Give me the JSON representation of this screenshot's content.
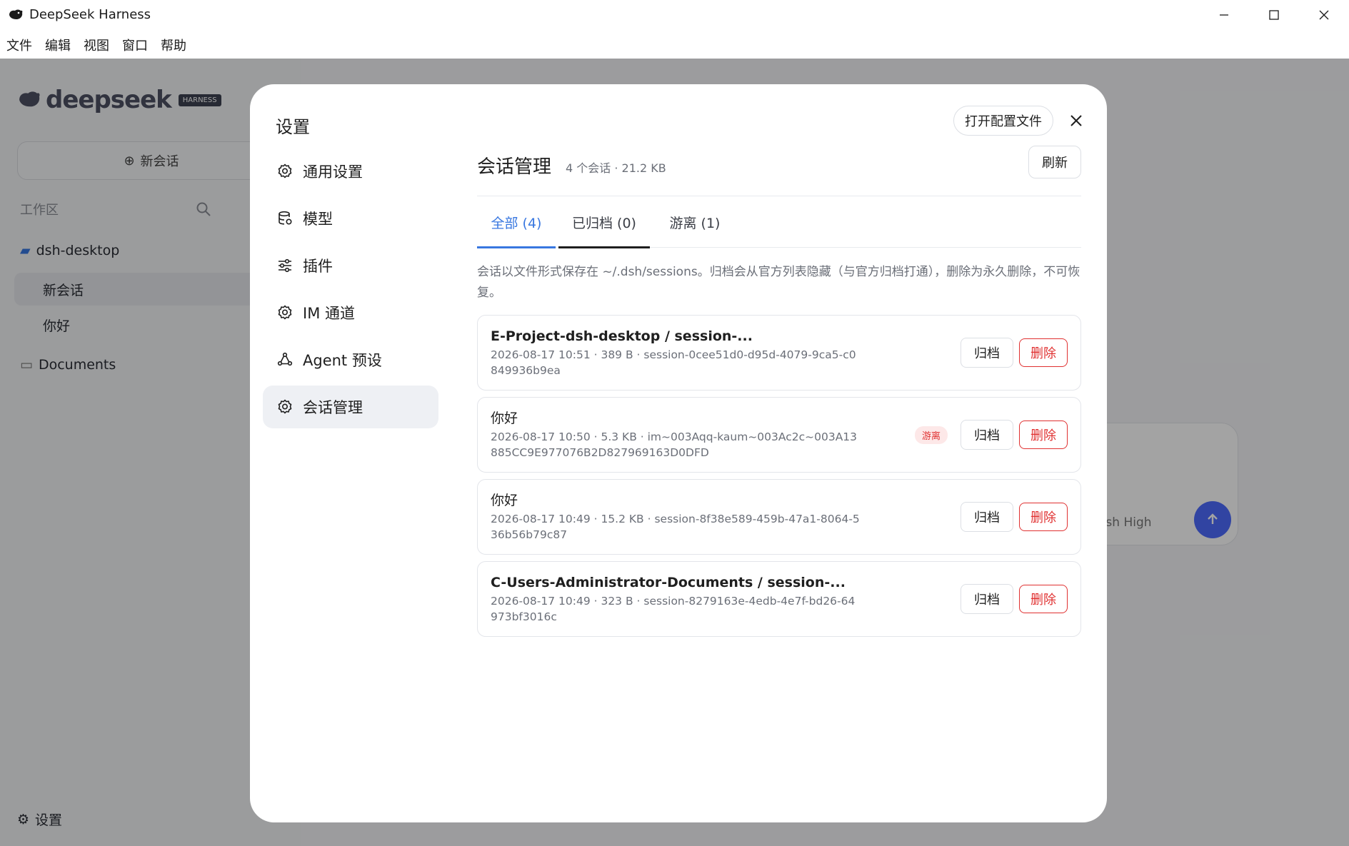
{
  "window": {
    "title": "DeepSeek Harness",
    "minimize_icon": "minimize-icon",
    "maximize_icon": "maximize-icon",
    "close_icon": "close-icon"
  },
  "menu": [
    "文件",
    "编辑",
    "视图",
    "窗口",
    "帮助"
  ],
  "sidebar": {
    "logo_text": "deepseek",
    "logo_badge": "HARNESS",
    "new_chat": "新会话",
    "section_label": "工作区",
    "workspace": "dsh-desktop",
    "sessions": [
      "新会话",
      "你好"
    ],
    "folder": "Documents",
    "settings": "设置"
  },
  "composer": {
    "model_label": "ash High"
  },
  "modal": {
    "title": "设置",
    "open_config": "打开配置文件",
    "nav": [
      {
        "label": "通用设置",
        "icon": "gear-icon"
      },
      {
        "label": "模型",
        "icon": "database-icon"
      },
      {
        "label": "插件",
        "icon": "sliders-icon"
      },
      {
        "label": "IM 通道",
        "icon": "gear-icon"
      },
      {
        "label": "Agent 预设",
        "icon": "agent-icon"
      },
      {
        "label": "会话管理",
        "icon": "gear-icon"
      }
    ],
    "active_nav": 5,
    "section": {
      "title": "会话管理",
      "meta": "4 个会话 · 21.2 KB",
      "refresh": "刷新",
      "tabs": [
        {
          "label": "全部 (4)",
          "state": "active"
        },
        {
          "label": "已归档 (0)",
          "state": "underlined"
        },
        {
          "label": "游离 (1)",
          "state": "normal"
        }
      ],
      "description": "会话以文件形式保存在 ~/.dsh/sessions。归档会从官方列表隐藏（与官方归档打通），删除为永久删除，不可恢复。",
      "archive_label": "归档",
      "delete_label": "删除",
      "orphan_label": "游离",
      "sessions": [
        {
          "title": "E-Project-dsh-desktop / session-...",
          "meta": "2026-08-17 10:51 · 389 B · session-0cee51d0-d95d-4079-9ca5-c0849936b9ea",
          "orphan": false,
          "bold": true
        },
        {
          "title": "你好",
          "meta": "2026-08-17 10:50 · 5.3 KB · im~003Aqq-kaum~003Ac2c~003A13885CC9E977076B2D827969163D0DFD",
          "orphan": true,
          "bold": false
        },
        {
          "title": "你好",
          "meta": "2026-08-17 10:49 · 15.2 KB · session-8f38e589-459b-47a1-8064-536b56b79c87",
          "orphan": false,
          "bold": false
        },
        {
          "title": "C-Users-Administrator-Documents / session-...",
          "meta": "2026-08-17 10:49 · 323 B · session-8279163e-4edb-4e7f-bd26-64973bf3016c",
          "orphan": false,
          "bold": true
        }
      ]
    }
  },
  "colors": {
    "accent": "#3877e0",
    "danger": "#e03131",
    "orphan_bg": "#fde8e8"
  }
}
